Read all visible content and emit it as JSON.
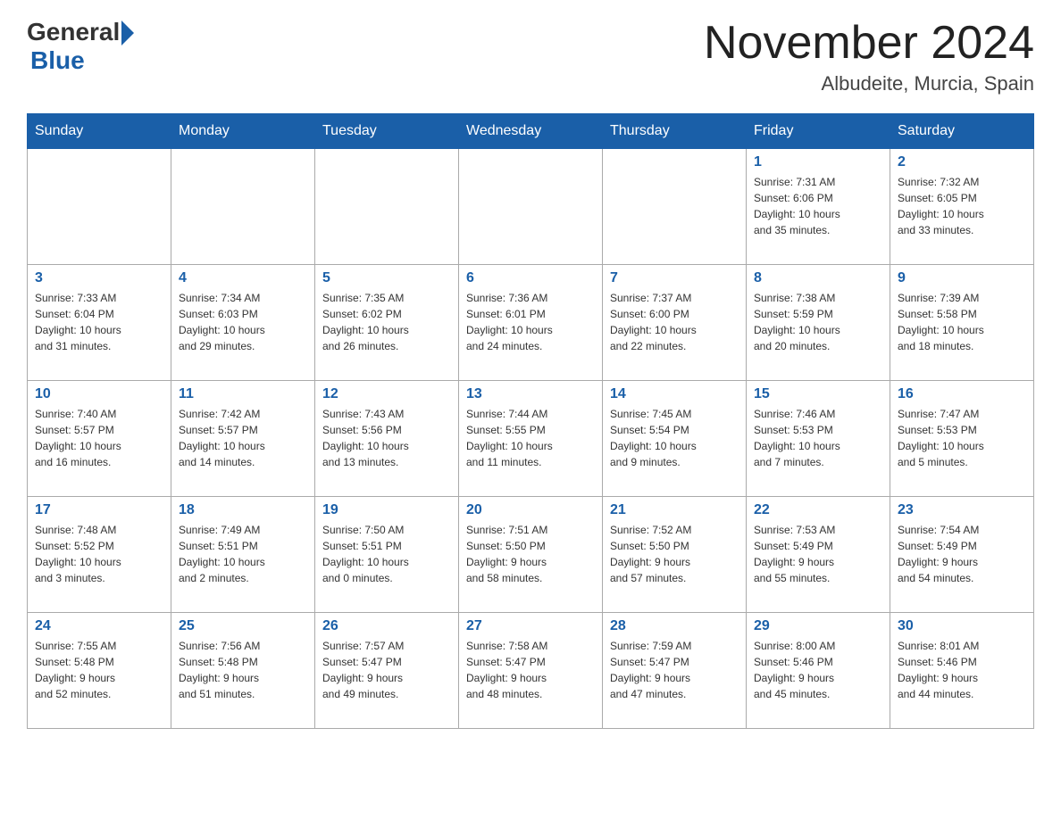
{
  "header": {
    "logo_general": "General",
    "logo_blue": "Blue",
    "month_title": "November 2024",
    "location": "Albudeite, Murcia, Spain"
  },
  "weekdays": [
    "Sunday",
    "Monday",
    "Tuesday",
    "Wednesday",
    "Thursday",
    "Friday",
    "Saturday"
  ],
  "weeks": [
    [
      {
        "day": "",
        "info": ""
      },
      {
        "day": "",
        "info": ""
      },
      {
        "day": "",
        "info": ""
      },
      {
        "day": "",
        "info": ""
      },
      {
        "day": "",
        "info": ""
      },
      {
        "day": "1",
        "info": "Sunrise: 7:31 AM\nSunset: 6:06 PM\nDaylight: 10 hours\nand 35 minutes."
      },
      {
        "day": "2",
        "info": "Sunrise: 7:32 AM\nSunset: 6:05 PM\nDaylight: 10 hours\nand 33 minutes."
      }
    ],
    [
      {
        "day": "3",
        "info": "Sunrise: 7:33 AM\nSunset: 6:04 PM\nDaylight: 10 hours\nand 31 minutes."
      },
      {
        "day": "4",
        "info": "Sunrise: 7:34 AM\nSunset: 6:03 PM\nDaylight: 10 hours\nand 29 minutes."
      },
      {
        "day": "5",
        "info": "Sunrise: 7:35 AM\nSunset: 6:02 PM\nDaylight: 10 hours\nand 26 minutes."
      },
      {
        "day": "6",
        "info": "Sunrise: 7:36 AM\nSunset: 6:01 PM\nDaylight: 10 hours\nand 24 minutes."
      },
      {
        "day": "7",
        "info": "Sunrise: 7:37 AM\nSunset: 6:00 PM\nDaylight: 10 hours\nand 22 minutes."
      },
      {
        "day": "8",
        "info": "Sunrise: 7:38 AM\nSunset: 5:59 PM\nDaylight: 10 hours\nand 20 minutes."
      },
      {
        "day": "9",
        "info": "Sunrise: 7:39 AM\nSunset: 5:58 PM\nDaylight: 10 hours\nand 18 minutes."
      }
    ],
    [
      {
        "day": "10",
        "info": "Sunrise: 7:40 AM\nSunset: 5:57 PM\nDaylight: 10 hours\nand 16 minutes."
      },
      {
        "day": "11",
        "info": "Sunrise: 7:42 AM\nSunset: 5:57 PM\nDaylight: 10 hours\nand 14 minutes."
      },
      {
        "day": "12",
        "info": "Sunrise: 7:43 AM\nSunset: 5:56 PM\nDaylight: 10 hours\nand 13 minutes."
      },
      {
        "day": "13",
        "info": "Sunrise: 7:44 AM\nSunset: 5:55 PM\nDaylight: 10 hours\nand 11 minutes."
      },
      {
        "day": "14",
        "info": "Sunrise: 7:45 AM\nSunset: 5:54 PM\nDaylight: 10 hours\nand 9 minutes."
      },
      {
        "day": "15",
        "info": "Sunrise: 7:46 AM\nSunset: 5:53 PM\nDaylight: 10 hours\nand 7 minutes."
      },
      {
        "day": "16",
        "info": "Sunrise: 7:47 AM\nSunset: 5:53 PM\nDaylight: 10 hours\nand 5 minutes."
      }
    ],
    [
      {
        "day": "17",
        "info": "Sunrise: 7:48 AM\nSunset: 5:52 PM\nDaylight: 10 hours\nand 3 minutes."
      },
      {
        "day": "18",
        "info": "Sunrise: 7:49 AM\nSunset: 5:51 PM\nDaylight: 10 hours\nand 2 minutes."
      },
      {
        "day": "19",
        "info": "Sunrise: 7:50 AM\nSunset: 5:51 PM\nDaylight: 10 hours\nand 0 minutes."
      },
      {
        "day": "20",
        "info": "Sunrise: 7:51 AM\nSunset: 5:50 PM\nDaylight: 9 hours\nand 58 minutes."
      },
      {
        "day": "21",
        "info": "Sunrise: 7:52 AM\nSunset: 5:50 PM\nDaylight: 9 hours\nand 57 minutes."
      },
      {
        "day": "22",
        "info": "Sunrise: 7:53 AM\nSunset: 5:49 PM\nDaylight: 9 hours\nand 55 minutes."
      },
      {
        "day": "23",
        "info": "Sunrise: 7:54 AM\nSunset: 5:49 PM\nDaylight: 9 hours\nand 54 minutes."
      }
    ],
    [
      {
        "day": "24",
        "info": "Sunrise: 7:55 AM\nSunset: 5:48 PM\nDaylight: 9 hours\nand 52 minutes."
      },
      {
        "day": "25",
        "info": "Sunrise: 7:56 AM\nSunset: 5:48 PM\nDaylight: 9 hours\nand 51 minutes."
      },
      {
        "day": "26",
        "info": "Sunrise: 7:57 AM\nSunset: 5:47 PM\nDaylight: 9 hours\nand 49 minutes."
      },
      {
        "day": "27",
        "info": "Sunrise: 7:58 AM\nSunset: 5:47 PM\nDaylight: 9 hours\nand 48 minutes."
      },
      {
        "day": "28",
        "info": "Sunrise: 7:59 AM\nSunset: 5:47 PM\nDaylight: 9 hours\nand 47 minutes."
      },
      {
        "day": "29",
        "info": "Sunrise: 8:00 AM\nSunset: 5:46 PM\nDaylight: 9 hours\nand 45 minutes."
      },
      {
        "day": "30",
        "info": "Sunrise: 8:01 AM\nSunset: 5:46 PM\nDaylight: 9 hours\nand 44 minutes."
      }
    ]
  ]
}
